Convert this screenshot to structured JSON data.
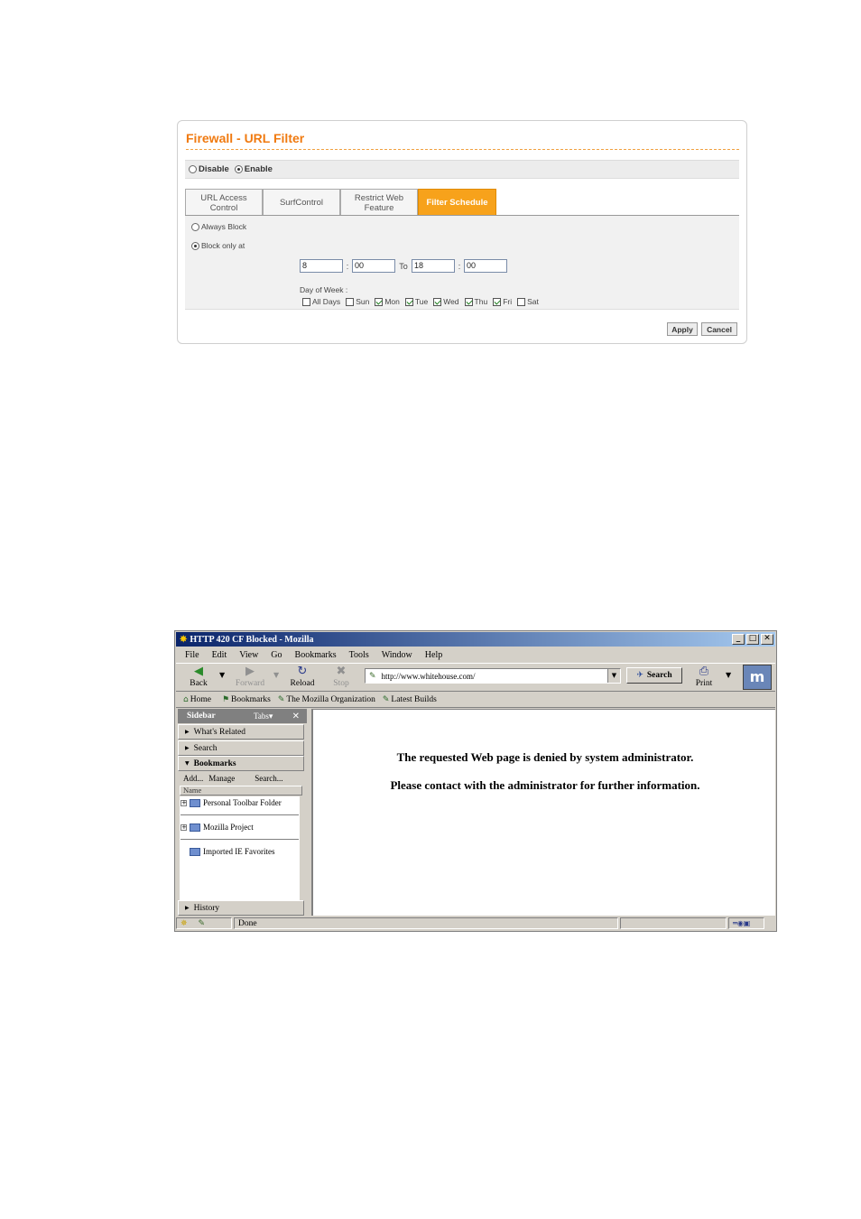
{
  "firewall": {
    "title": "Firewall - URL Filter",
    "disable_label": "Disable",
    "enable_label": "Enable",
    "tabs": [
      {
        "label": "URL Access Control"
      },
      {
        "label": "SurfControl"
      },
      {
        "label": "Restrict Web Feature"
      },
      {
        "label": "Filter Schedule"
      }
    ],
    "always_block_label": "Always Block",
    "block_only_at_label": "Block only at",
    "time": {
      "start_hour": "8",
      "start_min": "00",
      "to_label": "To",
      "end_hour": "18",
      "end_min": "00",
      "separator": ":"
    },
    "day_of_week_label": "Day of Week :",
    "days": [
      {
        "label": "All Days",
        "checked": false
      },
      {
        "label": "Sun",
        "checked": false
      },
      {
        "label": "Mon",
        "checked": true
      },
      {
        "label": "Tue",
        "checked": true
      },
      {
        "label": "Wed",
        "checked": true
      },
      {
        "label": "Thu",
        "checked": true
      },
      {
        "label": "Fri",
        "checked": true
      },
      {
        "label": "Sat",
        "checked": false
      }
    ],
    "apply_label": "Apply",
    "cancel_label": "Cancel",
    "accent_color": "#f7a21b"
  },
  "browser": {
    "title": "HTTP 420 CF Blocked - Mozilla",
    "menu": [
      "File",
      "Edit",
      "View",
      "Go",
      "Bookmarks",
      "Tools",
      "Window",
      "Help"
    ],
    "toolbar": {
      "back": "Back",
      "forward": "Forward",
      "reload": "Reload",
      "stop": "Stop",
      "url": "http://www.whitehouse.com/",
      "search": "Search",
      "print": "Print"
    },
    "personal_toolbar": [
      "Home",
      "Bookmarks",
      "The Mozilla Organization",
      "Latest Builds"
    ],
    "sidebar": {
      "title": "Sidebar",
      "tabs_label": "Tabs",
      "sections": {
        "whats_related": "What's Related",
        "search": "Search",
        "bookmarks": "Bookmarks",
        "history": "History"
      },
      "actions": [
        "Add...",
        "Manage",
        "Search..."
      ],
      "column_name": "Name",
      "items": [
        "Personal Toolbar Folder",
        "Mozilla Project",
        "Imported IE Favorites"
      ]
    },
    "messages": [
      "The requested Web page is denied by system administrator.",
      "Please contact with the administrator for further information."
    ],
    "status": "Done"
  }
}
